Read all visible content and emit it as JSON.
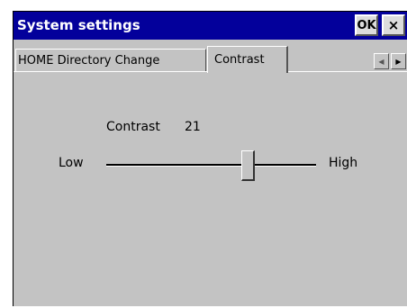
{
  "window": {
    "title": "System settings",
    "ok_label": "OK",
    "close_label": "×"
  },
  "tabs": [
    {
      "label": "HOME Directory Change",
      "selected": false
    },
    {
      "label": "Contrast",
      "selected": true
    }
  ],
  "tab_scroll": {
    "left": "◀",
    "right": "▶"
  },
  "contrast": {
    "label": "Contrast",
    "value": "21",
    "low_label": "Low",
    "high_label": "High",
    "slider_fraction": 0.68
  },
  "colors": {
    "titlebar": "#03009b",
    "window_bg": "#c3c3c3"
  }
}
